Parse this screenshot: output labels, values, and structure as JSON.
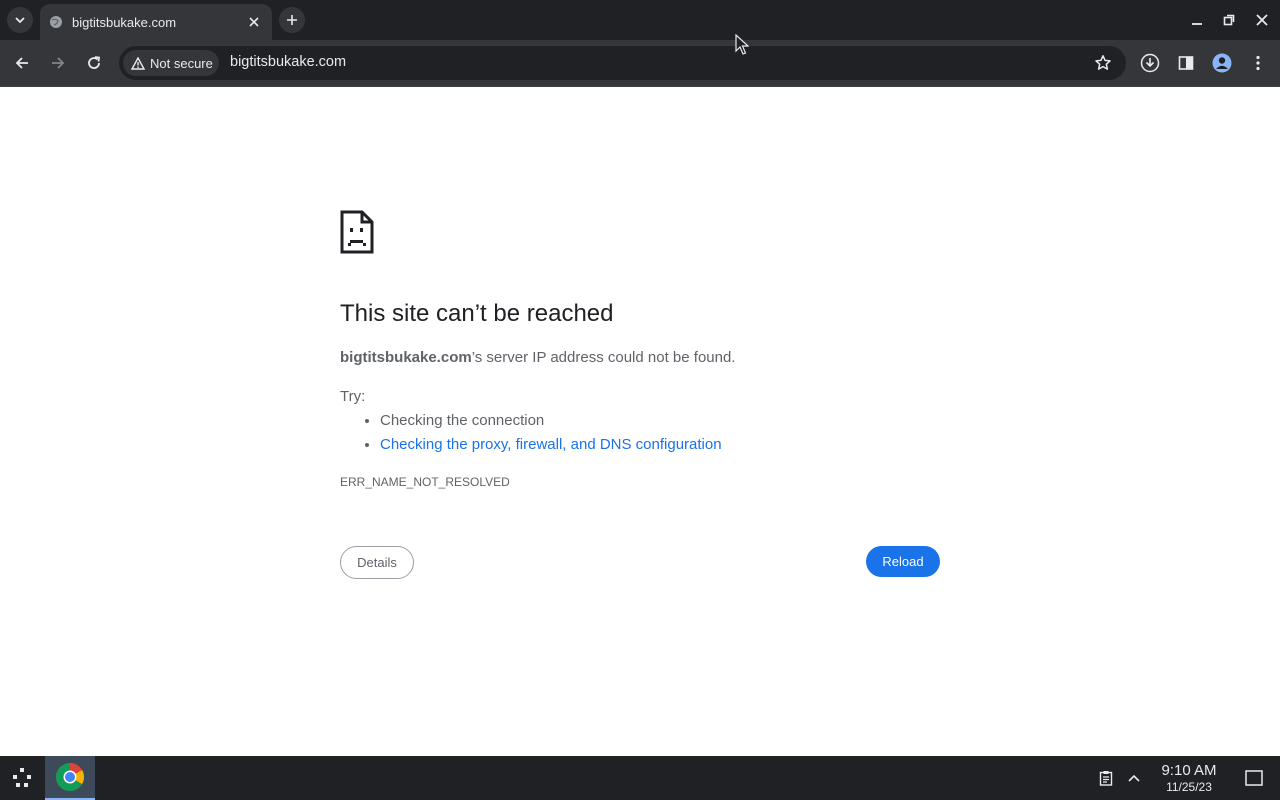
{
  "browser": {
    "tab": {
      "title": "bigtitsbukake.com"
    },
    "toolbar": {
      "security_label": "Not secure",
      "url": "bigtitsbukake.com"
    }
  },
  "page": {
    "heading": "This site can’t be reached",
    "summary_host": "bigtitsbukake.com",
    "summary_rest": "’s server IP address could not be found.",
    "try_label": "Try:",
    "suggestions": [
      "Checking the connection",
      "Checking the proxy, firewall, and DNS configuration"
    ],
    "error_code": "ERR_NAME_NOT_RESOLVED",
    "details_label": "Details",
    "reload_label": "Reload"
  },
  "taskbar": {
    "time": "9:10 AM",
    "date": "11/25/23"
  },
  "colors": {
    "accent": "#1a73e8",
    "link": "#1a73e8",
    "frame": "#202124",
    "toolbar": "#35363a"
  },
  "icons": [
    "tab-search-icon",
    "globe-favicon-icon",
    "close-icon",
    "plus-icon",
    "minimize-icon",
    "restore-icon",
    "window-close-icon",
    "back-arrow-icon",
    "forward-arrow-icon",
    "reload-icon",
    "warning-icon",
    "star-icon",
    "download-icon",
    "side-panel-icon",
    "profile-icon",
    "more-vert-icon",
    "sad-page-icon",
    "launcher-icon",
    "chrome-icon",
    "clipboard-icon",
    "chevron-up-icon",
    "overview-icon"
  ]
}
